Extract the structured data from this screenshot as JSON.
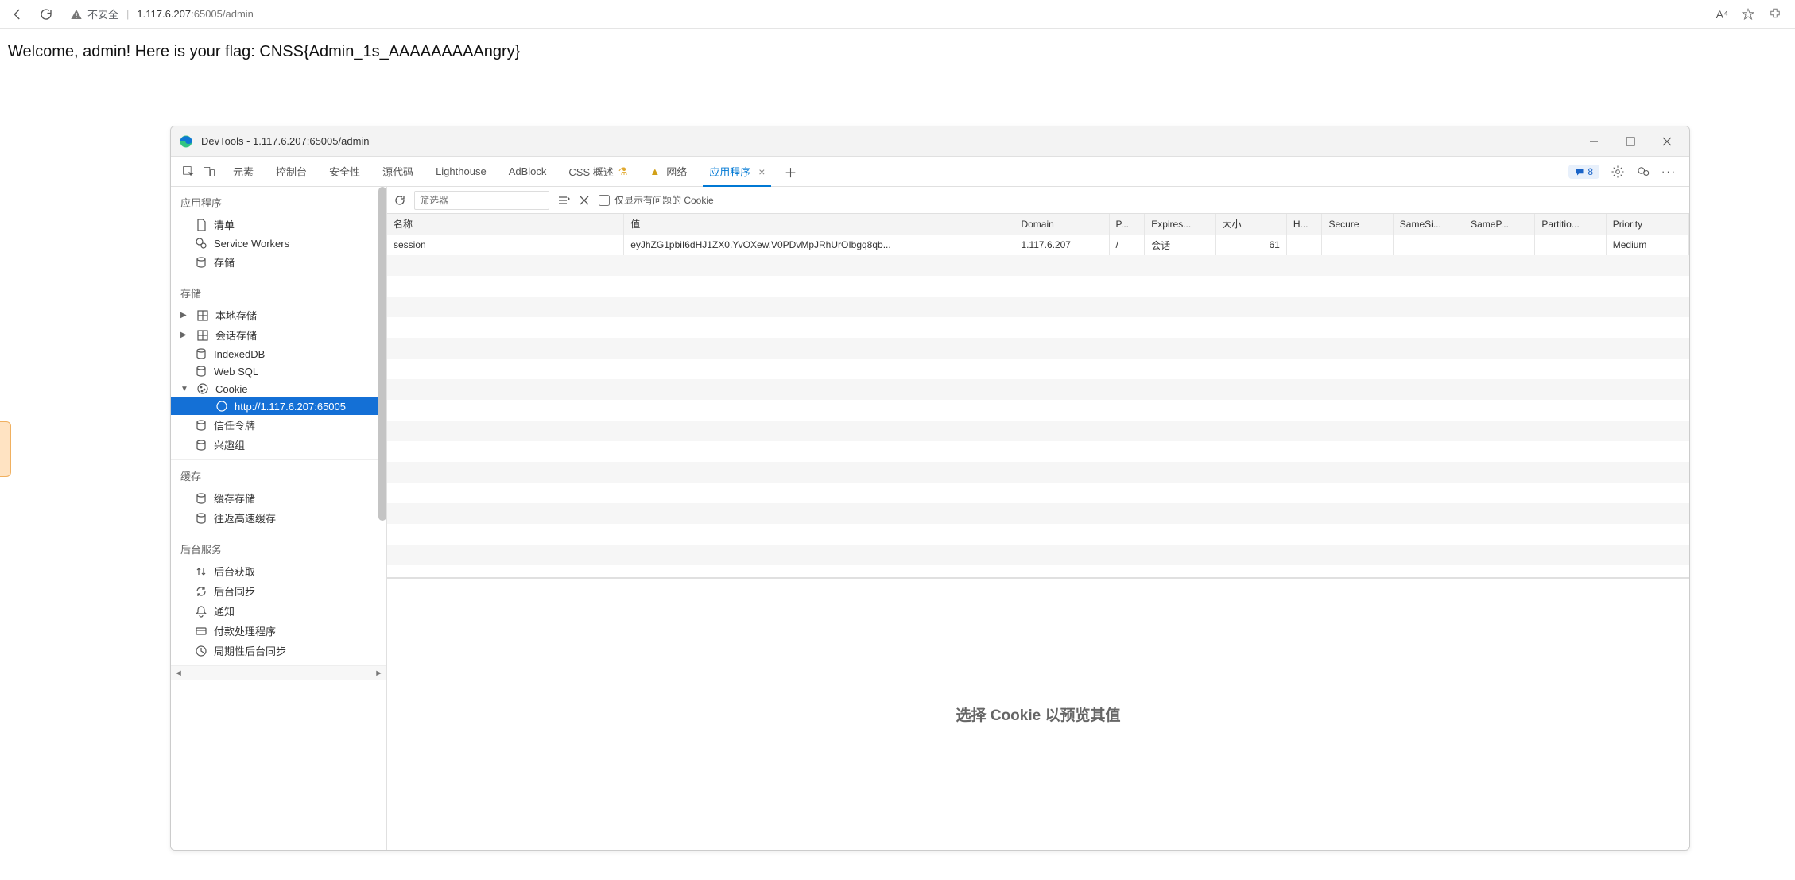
{
  "browser": {
    "insecure_label": "不安全",
    "url_host": "1.117.6.207",
    "url_rest": ":65005/admin",
    "text_size_label": "A⁴"
  },
  "page": {
    "flag_text": "Welcome, admin! Here is your flag: CNSS{Admin_1s_AAAAAAAAAngry}"
  },
  "devtools": {
    "title": "DevTools - 1.117.6.207:65005/admin",
    "tabs": [
      "元素",
      "控制台",
      "安全性",
      "源代码",
      "Lighthouse",
      "AdBlock",
      "CSS 概述",
      "网络",
      "应用程序"
    ],
    "active_tab": "应用程序",
    "issues_count": "8",
    "toolbar": {
      "filter_placeholder": "筛选器",
      "only_issues_label": "仅显示有问题的 Cookie"
    },
    "sidebar": {
      "app": {
        "title": "应用程序",
        "items": [
          "清单",
          "Service Workers",
          "存储"
        ]
      },
      "storage": {
        "title": "存储",
        "local": "本地存储",
        "session": "会话存储",
        "indexeddb": "IndexedDB",
        "websql": "Web SQL",
        "cookie": "Cookie",
        "cookie_origin": "http://1.117.6.207:65005",
        "trust_tokens": "信任令牌",
        "interest_groups": "兴趣组"
      },
      "cache": {
        "title": "缓存",
        "items": [
          "缓存存储",
          "往返高速缓存"
        ]
      },
      "bg": {
        "title": "后台服务",
        "items": [
          "后台获取",
          "后台同步",
          "通知",
          "付款处理程序",
          "周期性后台同步"
        ]
      }
    },
    "table": {
      "headers": [
        "名称",
        "值",
        "Domain",
        "P...",
        "Expires...",
        "大小",
        "H...",
        "Secure",
        "SameSi...",
        "SameP...",
        "Partitio...",
        "Priority"
      ],
      "rows": [
        {
          "name": "session",
          "value": "eyJhZG1pbiI6dHJ1ZX0.YvOXew.V0PDvMpJRhUrOIbgq8qb...",
          "domain": "1.117.6.207",
          "path": "/",
          "expires": "会话",
          "size": "61",
          "httponly": "",
          "secure": "",
          "samesite": "",
          "samep": "",
          "partition": "",
          "priority": "Medium"
        }
      ]
    },
    "preview_hint": "选择 Cookie 以预览其值"
  }
}
